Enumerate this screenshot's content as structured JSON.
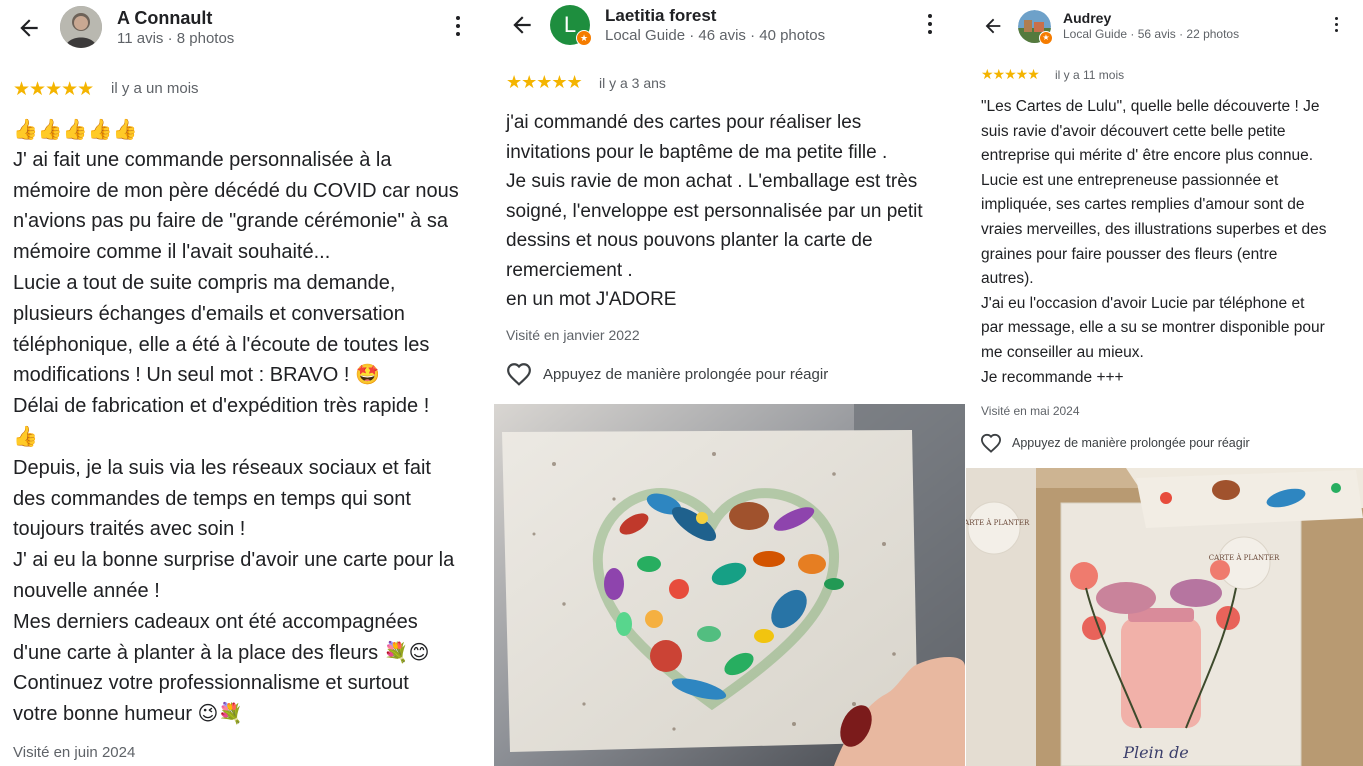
{
  "reviews": [
    {
      "name": "A Connault",
      "meta": "11 avis · 8 photos",
      "stars": "★★★★★",
      "date": "il y a un mois",
      "emoji_line": "👍👍👍👍👍",
      "lines": [
        "J' ai fait une commande personnalisée à la",
        "mémoire de mon père décédé du COVID car nous",
        "n'avions pas pu faire de \"grande cérémonie\" à sa",
        "mémoire comme il l'avait souhaité...",
        "Lucie a tout de suite compris ma demande,",
        "plusieurs échanges d'emails et conversation",
        "téléphonique, elle a été à l'écoute de toutes les",
        "modifications ! Un seul mot : BRAVO ! 🤩",
        "Délai de fabrication et d'expédition très rapide !",
        "👍",
        "Depuis, je la suis via les réseaux sociaux et fait",
        "des commandes de temps en temps qui sont",
        "toujours traités avec soin !",
        "J' ai eu la bonne surprise d'avoir une carte pour la",
        "nouvelle année !",
        "Mes derniers cadeaux ont été accompagnées",
        "d'une carte à planter à la place des fleurs 💐😊",
        "Continuez votre professionnalisme et surtout",
        "votre bonne humeur 😉💐"
      ],
      "visited": "Visité en juin 2024"
    },
    {
      "name": "Laetitia forest",
      "avatar_letter": "L",
      "meta": "Local Guide · 46 avis · 40 photos",
      "stars": "★★★★★",
      "date": "il y a 3 ans",
      "lines": [
        "j'ai commandé des cartes pour réaliser les",
        "invitations pour le baptême de ma petite fille .",
        "Je suis ravie de mon achat . L'emballage est très",
        "soigné, l'enveloppe est personnalisée par un petit",
        "dessins et nous pouvons planter la carte de",
        "remerciement .",
        "en un mot J'ADORE"
      ],
      "visited": "Visité en janvier 2022",
      "react_label": "Appuyez de manière prolongée pour réagir"
    },
    {
      "name": "Audrey",
      "meta": "Local Guide · 56 avis · 22 photos",
      "stars": "★★★★★",
      "date": "il y a 11 mois",
      "lines": [
        "\"Les Cartes de Lulu\", quelle belle découverte ! Je",
        "suis ravie d'avoir découvert cette belle petite",
        "entreprise qui mérite d' être encore plus connue.",
        "Lucie est une entrepreneuse passionnée et",
        "impliquée, ses cartes remplies d'amour sont de",
        "vraies merveilles, des illustrations superbes et des",
        "graines pour faire pousser des fleurs (entre",
        "autres).",
        "J'ai eu l'occasion d'avoir Lucie par téléphone et",
        "par message, elle a su se montrer disponible pour",
        "me conseiller au mieux.",
        "Je recommande +++"
      ],
      "visited": "Visité en mai 2024",
      "react_label": "Appuyez de manière prolongée pour réagir",
      "photo_texts": {
        "sticker": "CARTE À PLANTER",
        "caption": "Plein de"
      }
    }
  ],
  "colors": {
    "star": "#f4b400",
    "text": "#202124",
    "secondary": "#5f6368",
    "avatar_green": "#1e8e3e",
    "guide_badge": "#f57c00"
  }
}
